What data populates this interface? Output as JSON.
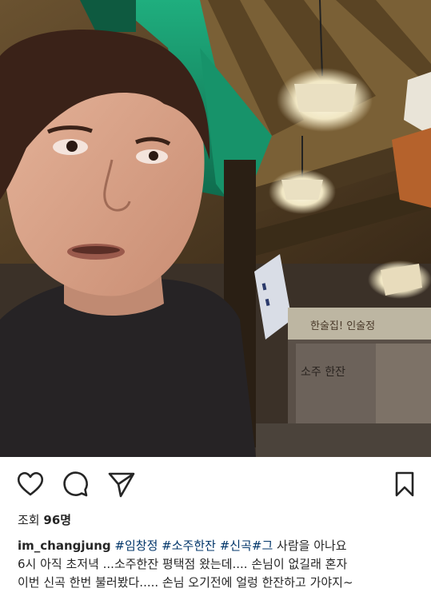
{
  "post": {
    "views_label": "조회",
    "views_count": "96명",
    "username": "im_changjung",
    "hashtags": [
      "#임창정",
      "#소주한잔",
      "#신곡",
      "#그"
    ],
    "caption_tail": " 사람을 아나요",
    "caption_line2": "6시  아직 초저녁 ...소주한잔 평택점 왔는데.... 손님이 없길래 혼자",
    "caption_line3": "이번 신곡 한번 불러봤다..... 손님 오기전에 얼렁 한잔하고 가야지~"
  },
  "media": {
    "sign_text": "한술집! 인술정",
    "poster_text": "소주 한잔"
  },
  "actions": {
    "like_icon": "heart-outline-icon",
    "comment_icon": "speech-bubble-icon",
    "share_icon": "paper-plane-icon",
    "save_icon": "bookmark-icon"
  },
  "colors": {
    "text": "#262626",
    "hashtag": "#003569",
    "accent_green": "#3fd6a0"
  }
}
